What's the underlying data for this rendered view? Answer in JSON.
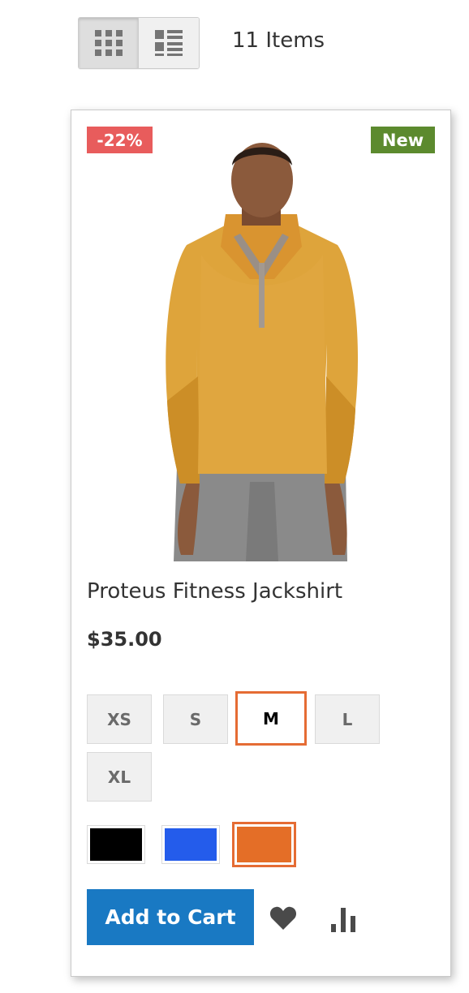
{
  "toolbar": {
    "modes": [
      {
        "label": "Grid",
        "icon": "grid-icon",
        "active": true
      },
      {
        "label": "List",
        "icon": "list-icon",
        "active": false
      }
    ],
    "items_count": "11 Items"
  },
  "product": {
    "badge_discount": "-22%",
    "badge_new": "New",
    "name": "Proteus Fitness Jackshirt",
    "price": "$35.00",
    "sizes": [
      "XS",
      "S",
      "M",
      "L",
      "XL"
    ],
    "selected_size": "M",
    "colors": [
      {
        "name": "Black",
        "hex": "#000000"
      },
      {
        "name": "Blue",
        "hex": "#245ceb"
      },
      {
        "name": "Orange",
        "hex": "#e46e27"
      }
    ],
    "selected_color": "Orange",
    "add_to_cart_label": "Add to Cart",
    "image_icon": "product-photo"
  },
  "colors": {
    "discount_badge": "#e85c5c",
    "new_badge": "#5c8a2e",
    "primary_button": "#1979c3",
    "selected_outline": "#e56c34"
  }
}
